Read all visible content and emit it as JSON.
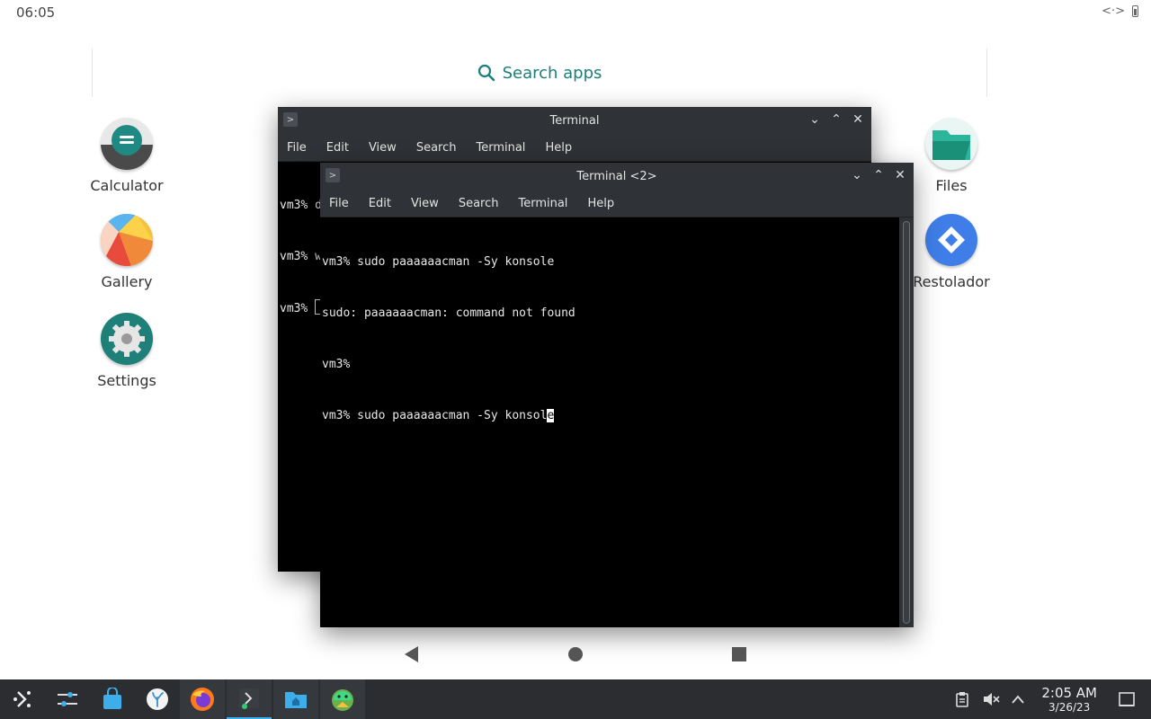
{
  "status_bar": {
    "time": "06:05"
  },
  "search": {
    "label": "Search apps"
  },
  "apps_left": [
    {
      "name": "Calculator"
    },
    {
      "name": "Gallery"
    },
    {
      "name": "Settings"
    }
  ],
  "apps_right": [
    {
      "name": "Files"
    },
    {
      "name": "Restolador"
    }
  ],
  "terminal1": {
    "title": "Terminal",
    "menu": [
      "File",
      "Edit",
      "View",
      "Search",
      "Terminal",
      "Help"
    ],
    "lines": [
      "vm3% d",
      "vm3% w",
      "vm3% "
    ]
  },
  "terminal2": {
    "title": "Terminal <2>",
    "menu": [
      "File",
      "Edit",
      "View",
      "Search",
      "Terminal",
      "Help"
    ],
    "lines": [
      "vm3% sudo paaaaaacman -Sy konsole",
      "sudo: paaaaaacman: command not found",
      "vm3%"
    ],
    "current_line_before_cursor": "vm3% sudo paaaaaacman -Sy konsol",
    "cursor_char": "e"
  },
  "taskbar": {
    "clock_time": "2:05 AM",
    "clock_date": "3/26/23"
  },
  "colors": {
    "accent": "#3daee9",
    "search_teal": "#1a7f7a",
    "window_chrome": "#2f3236",
    "taskbar": "#2b2d31"
  }
}
